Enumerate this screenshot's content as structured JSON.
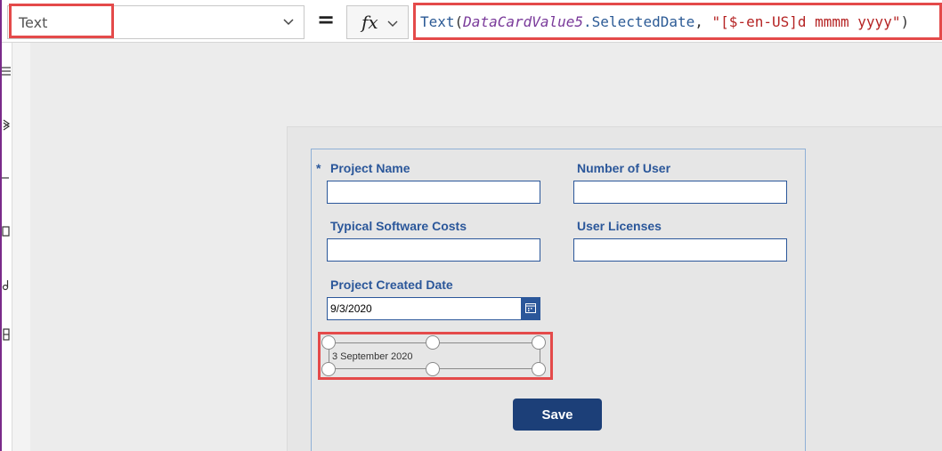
{
  "formula_bar": {
    "property": "Text",
    "equals": "=",
    "fx": "fx",
    "formula_tokens": [
      {
        "text": "Text",
        "kind": "fn"
      },
      {
        "text": "(",
        "kind": "punc"
      },
      {
        "text": "DataCardValue5",
        "kind": "var"
      },
      {
        "text": ".SelectedDate",
        "kind": "prop"
      },
      {
        "text": ", ",
        "kind": "punc"
      },
      {
        "text": "\"[$-en-US]d mmmm yyyy\"",
        "kind": "str"
      },
      {
        "text": ")",
        "kind": "punc"
      }
    ]
  },
  "form": {
    "fields": [
      {
        "label": "Project Name",
        "required": true
      },
      {
        "label": "Number of User",
        "required": false
      },
      {
        "label": "Typical Software Costs",
        "required": false
      },
      {
        "label": "User Licenses",
        "required": false
      }
    ],
    "date_field": {
      "label": "Project Created Date",
      "value": "9/3/2020"
    },
    "formatted_label": {
      "value": "3 September 2020"
    },
    "required_marker": "*",
    "save_label": "Save"
  },
  "colors": {
    "accent": "#2b579a",
    "save_button": "#1c3f78",
    "highlight": "#e44a4a"
  },
  "icons": [
    "chevron-down-icon",
    "calendar-icon",
    "hamburger-icon"
  ]
}
